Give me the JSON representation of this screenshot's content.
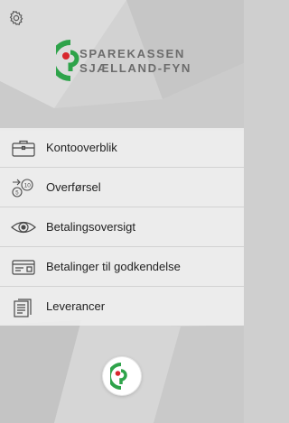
{
  "app": {
    "bank_name_line1": "SPAREKASSEN",
    "bank_name_line2": "SJÆLLAND-FYN"
  },
  "icons": {
    "settings": "gear-icon",
    "logo": "sparekassen-logo-icon"
  },
  "menu": {
    "items": [
      {
        "label": "Kontooverblik",
        "icon": "briefcase-icon"
      },
      {
        "label": "Overførsel",
        "icon": "coins-transfer-icon"
      },
      {
        "label": "Betalingsoversigt",
        "icon": "eye-icon"
      },
      {
        "label": "Betalinger til godkendelse",
        "icon": "payment-card-icon"
      },
      {
        "label": "Leverancer",
        "icon": "documents-icon"
      }
    ]
  },
  "colors": {
    "brand_green": "#2ea34a",
    "brand_red": "#d8262d",
    "logo_text": "#6c6c6c",
    "menu_bg": "#f0f0f0"
  }
}
